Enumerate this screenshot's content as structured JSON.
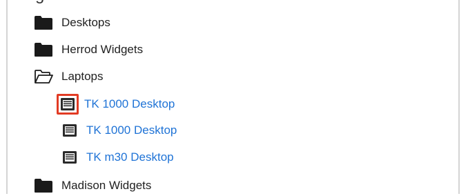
{
  "tree": {
    "top_cut_text": "g",
    "folders": [
      {
        "label": "Desktops",
        "icon": "folder-icon",
        "open": false
      },
      {
        "label": "Herrod Widgets",
        "icon": "folder-icon",
        "open": false
      },
      {
        "label": "Laptops",
        "icon": "folder-open-icon",
        "open": true
      },
      {
        "label": "Madison Widgets",
        "icon": "folder-icon",
        "open": false
      }
    ],
    "items": [
      {
        "label": "TK 1000 Desktop",
        "icon": "document-list-icon",
        "highlighted": true
      },
      {
        "label": "TK 1000 Desktop",
        "icon": "document-list-icon",
        "highlighted": false
      },
      {
        "label": "TK m30 Desktop",
        "icon": "document-list-icon",
        "highlighted": false
      }
    ]
  },
  "colors": {
    "link": "#1f73d6",
    "highlight_border": "#e23b24",
    "folder": "#1a1a1a"
  }
}
